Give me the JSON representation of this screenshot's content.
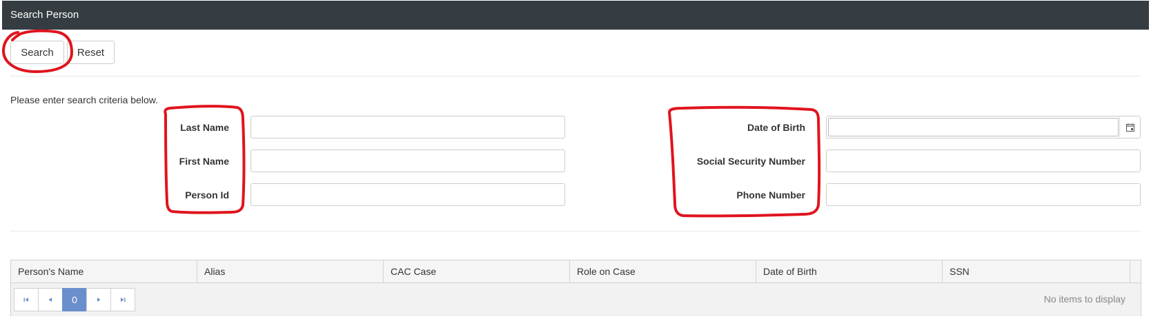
{
  "header": {
    "title": "Search Person"
  },
  "toolbar": {
    "search_label": "Search",
    "reset_label": "Reset"
  },
  "form": {
    "instructions": "Please enter search criteria below.",
    "last_name_label": "Last Name",
    "first_name_label": "First Name",
    "person_id_label": "Person Id",
    "dob_label": "Date of Birth",
    "ssn_label": "Social Security Number",
    "phone_label": "Phone Number",
    "last_name_value": "",
    "first_name_value": "",
    "person_id_value": "",
    "dob_value": "",
    "ssn_value": "",
    "phone_value": ""
  },
  "grid": {
    "columns": [
      "Person's Name",
      "Alias",
      "CAC Case",
      "Role on Case",
      "Date of Birth",
      "SSN"
    ],
    "page_number": "0",
    "empty_text": "No items to display"
  },
  "icons": {
    "calendar": "calendar-icon",
    "first_page": "first-page-icon",
    "prev_page": "prev-page-icon",
    "next_page": "next-page-icon",
    "last_page": "last-page-icon"
  },
  "colors": {
    "header_bg": "#353d42",
    "annotation": "#e0141e",
    "pager_active": "#6b8fcc"
  }
}
